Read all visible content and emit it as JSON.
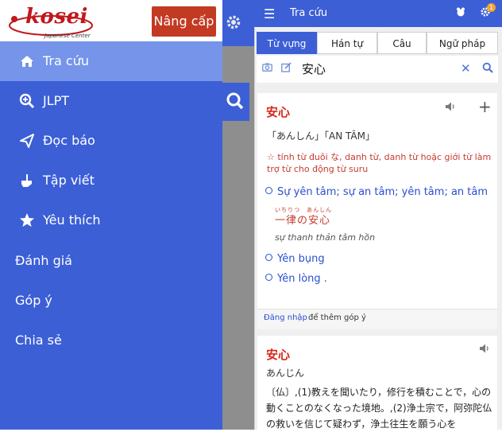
{
  "drawer": {
    "logo_text": "kosei",
    "logo_sub": "Japanese Center",
    "upgrade_label": "Nâng cấp",
    "items": [
      {
        "label": "Tra cứu",
        "icon": "home-icon"
      },
      {
        "label": "JLPT",
        "icon": "zoom-icon"
      },
      {
        "label": "Đọc báo",
        "icon": "send-icon"
      },
      {
        "label": "Tập viết",
        "icon": "pen-hand-icon"
      },
      {
        "label": "Yêu thích",
        "icon": "star-icon"
      }
    ],
    "plain_items": [
      "Đánh giá",
      "Góp ý",
      "Chia sẻ"
    ]
  },
  "topbar": {
    "title": "Tra cứu",
    "notification_count": "1"
  },
  "tabs": [
    "Từ vựng",
    "Hán tự",
    "Câu",
    "Ngữ pháp"
  ],
  "search": {
    "value": "安心"
  },
  "entry1": {
    "word": "安心",
    "reading": "「あんしん」「AN TÂM」",
    "pos": "☆ tính từ đuôi な, danh từ, danh từ hoặc giới từ làm trợ từ cho động từ suru",
    "sense1": "Sự yên tâm; sự an tâm; yên tâm; an tâm",
    "example_furigana": "いちりつ　あんしん",
    "example": "一律の安心",
    "example_translation": "sự thanh thản tâm hồn",
    "sense2": "Yên bụng",
    "sense3": "Yên lòng .",
    "login_link": "Đăng nhập",
    "contrib_text": "để thêm góp ý"
  },
  "entry2": {
    "word": "安心",
    "reading": "あんじん",
    "definition": "〔仏〕,(1)教えを聞いたり，修行を積むことで，心の動くことのなくなった境地。,(2)浄土宗で，阿弥陀仏の救いを信じて疑わず，浄土往生を願う心を"
  },
  "colors": {
    "primary": "#3c5fd6",
    "selected_nav": "#7594ea",
    "upgrade": "#c33a23",
    "headword": "#d62a1c"
  }
}
